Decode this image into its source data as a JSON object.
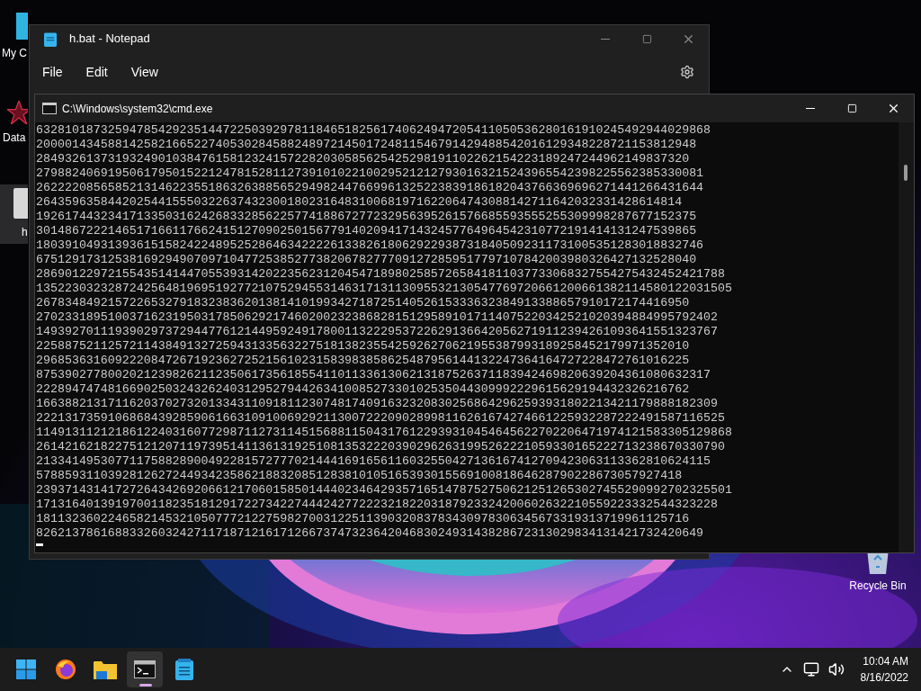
{
  "desktop": {
    "icons": [
      {
        "label": "My C",
        "kind": "monitor",
        "selected": false
      },
      {
        "label": "Data",
        "kind": "app",
        "selected": false
      },
      {
        "label": "h",
        "kind": "file",
        "selected": true
      }
    ],
    "recycle_bin": {
      "label": "Recycle Bin"
    }
  },
  "notepad": {
    "title": "h.bat - Notepad",
    "menu": [
      "File",
      "Edit",
      "View"
    ]
  },
  "console": {
    "title": "C:\\Windows\\system32\\cmd.exe",
    "lines": [
      "6328101873259478542923514472250392978118465182561740624947205411050536280161910245492944029868",
      "20000143458814258216652274053028458824897214501724811546791429488542016129348228721153812948",
      "2849326137319324901038476158123241572282030585625425298191102262154223189247244962149837320",
      "279882406919506179501522124781528112739101022100295212127930163215243965542398225562385330081",
      "262222085658521314622355186326388565294982447669961325223839186182043766369696271441266431644",
      "264359635844202544155503226374323001802316483100681971622064743088142711642032331428614814",
      "19261744323417133503162426833285622577418867277232956395261576685593555255309998287677152375",
      "30148672221465171661176624151270902501567791402094171432457764964542310772191414131247539865",
      "180391049313936151582422489525286463422226133826180629229387318405092311731005351283018832746",
      "67512917312538169294907097104772538527738206782777091272859517797107842003980326427132528040",
      "286901229721554351414470553931420223562312045471898025857265841811037733068327554275432452421788",
      "1352230323287242564819695192772107529455314631713113095532130547769720661200661382114580122031505",
      "2678348492157226532791832383620138141019934271872514052615333632384913388657910172174416950",
      "27023318951003716231950317850629217460200232386828151295891017114075220342521020394884995792402",
      "14939270111939029737294477612144959249178001132229537226291366420562719112394261093641551323767",
      "2258875211257211438491327259431335632275181382355425926270621955387993189258452179971352010",
      "2968536316092220847267192362725215610231583983858625487956144132247364164727228472761016225",
      "8753902778002021239826211235061735618554110113361306213187526371183942469820639204361080632317",
      "2228947474816690250324326240312952794426341008527330102535044309992229615629194432326216762",
      "16638821317116203702732013343110918112307481740916323208302568642962593931802213421179888182309",
      "222131735910686843928590616631091006929211300722209028998116261674274661225932287222491587116525",
      "1149131121218612240316077298711273114515688115043176122939310454645622702206471974121583305129868",
      "261421621822751212071197395141136131925108135322203902962631995262221059330165222713238670330790",
      "2133414953077117588289004922815727770214441691656116032550427136167412709423063113362810624115",
      "578859311039281262724493423586218832085128381010516539301556910081864628790228673057927418",
      "2393714314172726434269206612170601585014440234642935716514787527506212512653027455290992702325501",
      "17131640139197001182351812917227342274442427722232182203187923324200602632210559223332544323228",
      "1811323602246582145321050777212275982700312251139032083783430978306345673319313719961125716",
      "826213786168833260324271171871216171266737473236420468302493143828672313029834131421732420649"
    ]
  },
  "taskbar": {
    "apps": [
      {
        "kind": "start",
        "selected": false
      },
      {
        "kind": "browser",
        "selected": false
      },
      {
        "kind": "folder",
        "selected": false
      },
      {
        "kind": "terminal",
        "selected": true
      },
      {
        "kind": "notepad",
        "selected": false
      }
    ],
    "clock": {
      "time": "10:04 AM",
      "date": "8/16/2022"
    }
  }
}
